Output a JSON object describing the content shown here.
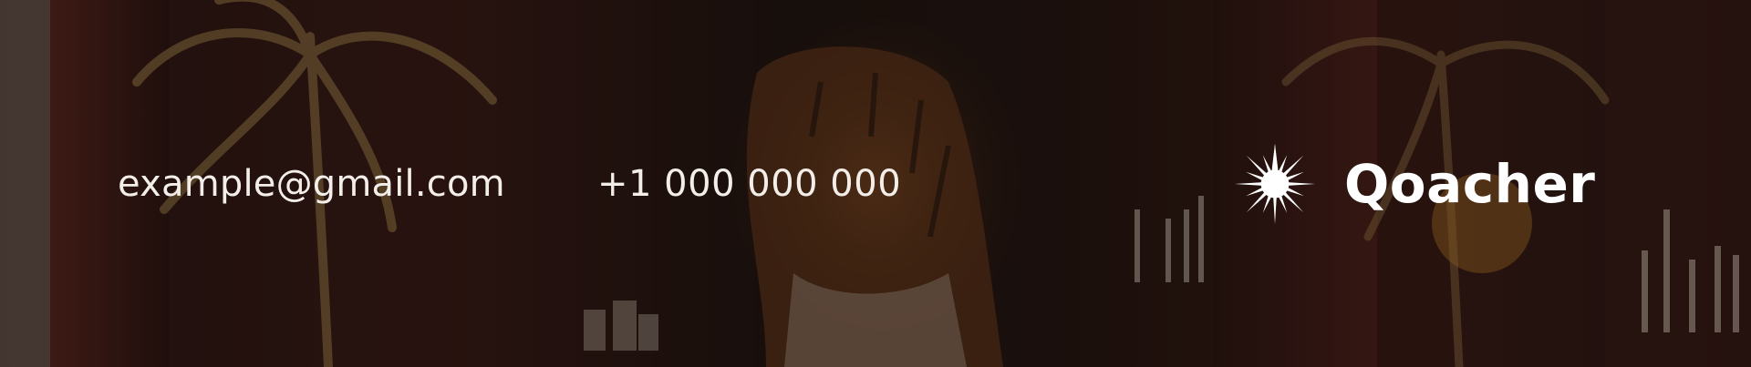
{
  "contact": {
    "email": "example@gmail.com",
    "phone": "+1 000 000 000"
  },
  "brand": {
    "name": "Qoacher",
    "icon": "starburst-logo-icon"
  },
  "colors": {
    "text": "#f3eee9",
    "background": "#2a1613",
    "accent": "#c89a55"
  }
}
